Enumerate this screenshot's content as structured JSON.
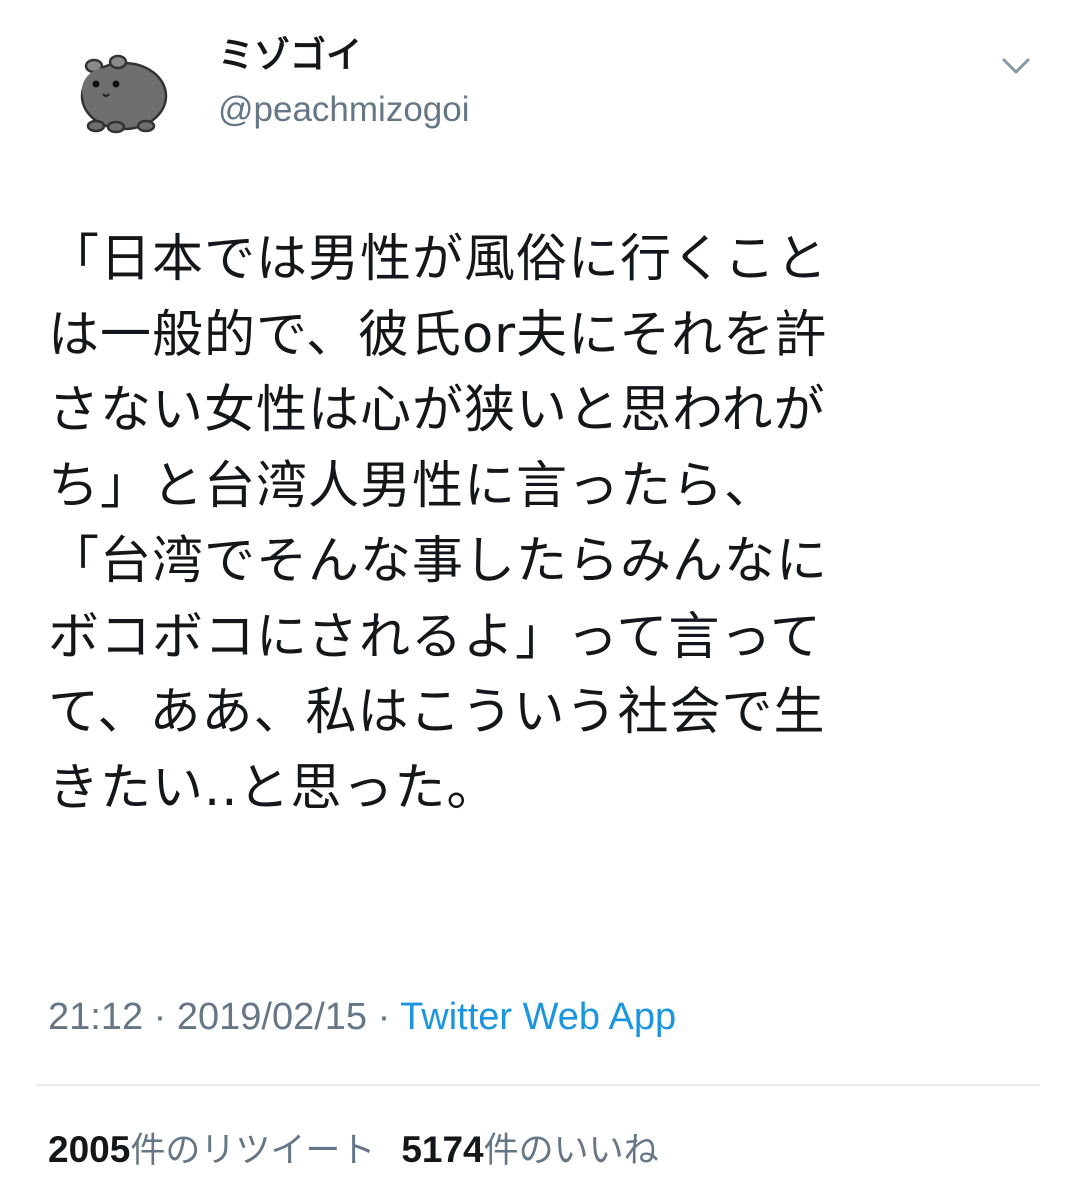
{
  "user": {
    "display_name": "ミゾゴイ",
    "handle": "@peachmizogoi",
    "avatar_icon": "guinea-pig-icon"
  },
  "tweet": {
    "text": "「日本では男性が風俗に行くこと\nは一般的で、彼氏or夫にそれを許\nさない女性は心が狭いと思われが\nち」と台湾人男性に言ったら、\n「台湾でそんな事したらみんなに\nボコボコにされるよ」って言って\nて、ああ、私はこういう社会で生\nきたい..と思った。",
    "time": "21:12",
    "separator": "·",
    "date": "2019/02/15",
    "source": "Twitter Web App"
  },
  "stats": {
    "retweets_count": "2005",
    "retweets_label": "件のリツイート",
    "likes_count": "5174",
    "likes_label": "件のいいね"
  },
  "colors": {
    "text": "#14171a",
    "secondary": "#657786",
    "link": "#1b95e0",
    "divider": "#e6ecf0",
    "avatar_fill": "#6f6f6f"
  },
  "icons": {
    "menu": "chevron-down-icon"
  }
}
